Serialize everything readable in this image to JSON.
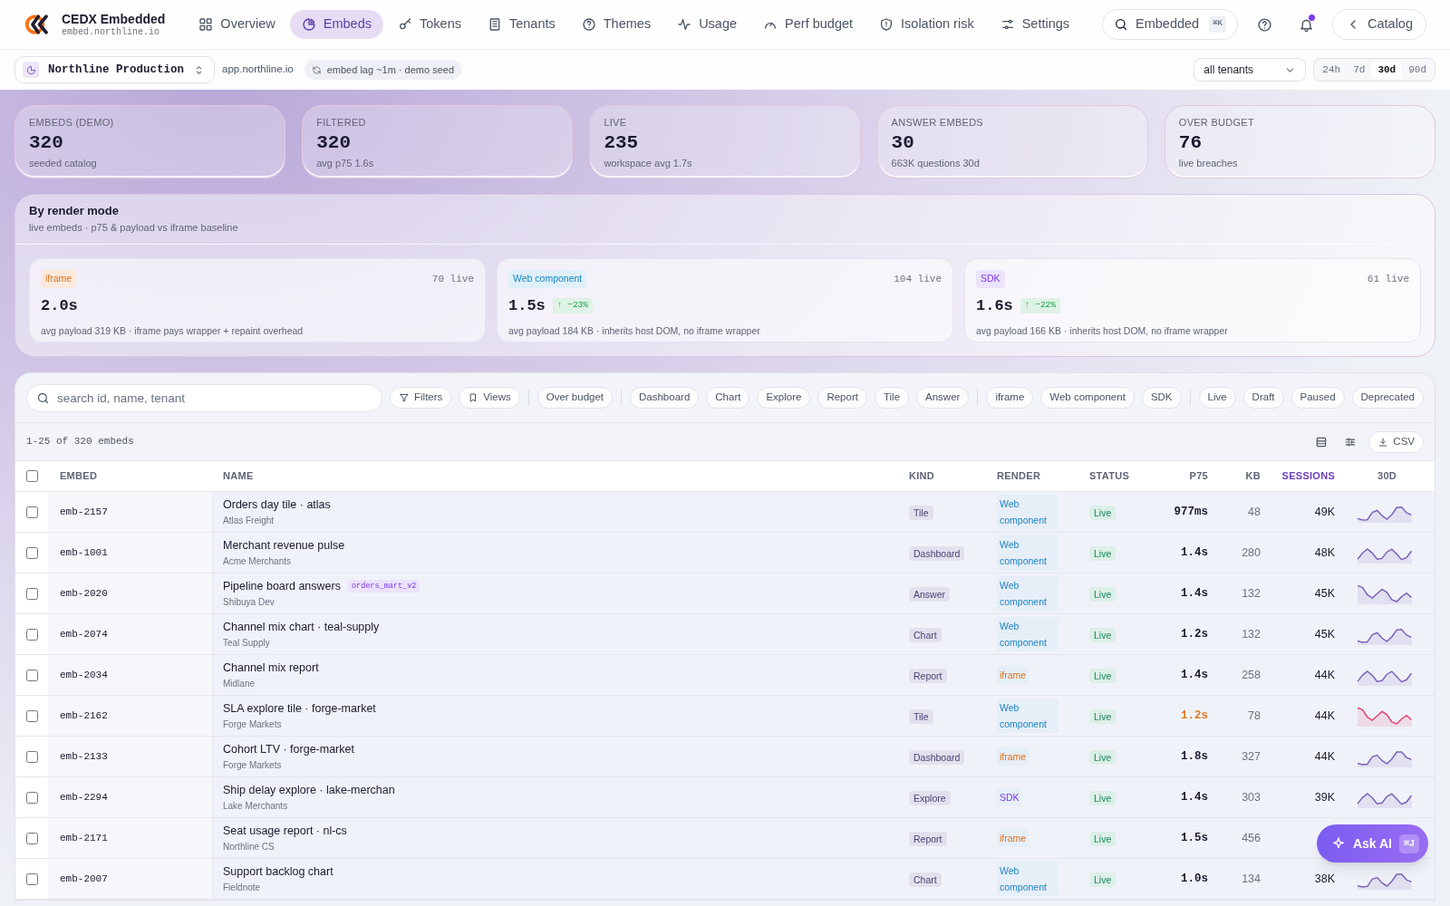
{
  "brand": {
    "name": "CEDX Embedded",
    "domain": "embed.northline.io"
  },
  "nav": [
    {
      "label": "Overview",
      "selected": false
    },
    {
      "label": "Embeds",
      "selected": true
    },
    {
      "label": "Tokens",
      "selected": false
    },
    {
      "label": "Tenants",
      "selected": false
    },
    {
      "label": "Themes",
      "selected": false
    },
    {
      "label": "Usage",
      "selected": false
    },
    {
      "label": "Perf budget",
      "selected": false
    },
    {
      "label": "Isolation risk",
      "selected": false
    },
    {
      "label": "Settings",
      "selected": false
    }
  ],
  "search": {
    "value": "Embedded",
    "shortcut": "⌘K"
  },
  "notifications": {
    "unread": true
  },
  "catalog_button": "Catalog",
  "workspace": {
    "name": "Northline Production",
    "host": "app.northline.io",
    "sync": "embed lag ~1m · demo seed"
  },
  "tenant_select": "all tenants",
  "ranges": [
    {
      "label": "24h",
      "selected": false
    },
    {
      "label": "7d",
      "selected": false
    },
    {
      "label": "30d",
      "selected": true
    },
    {
      "label": "90d",
      "selected": false
    }
  ],
  "stats": [
    {
      "label": "EMBEDS (DEMO)",
      "value": "320",
      "note": "seeded catalog"
    },
    {
      "label": "FILTERED",
      "value": "320",
      "note": "avg p75 1.6s"
    },
    {
      "label": "LIVE",
      "value": "235",
      "note": "workspace avg 1.7s"
    },
    {
      "label": "ANSWER EMBEDS",
      "value": "30",
      "note": "663K questions 30d"
    },
    {
      "label": "OVER BUDGET",
      "value": "76",
      "note": "live breaches"
    }
  ],
  "render_modes": {
    "title": "By render mode",
    "subtitle": "live embeds · p75 & payload vs iframe baseline",
    "modes": [
      {
        "tag": "iframe",
        "kind": "iframe",
        "count": "70 live",
        "p75": "2.0s",
        "note": "avg payload 319 KB · iframe pays wrapper + repaint overhead"
      },
      {
        "tag": "Web component",
        "kind": "web",
        "count": "104 live",
        "p75": "1.5s",
        "delta": "↑ −23%",
        "note": "avg payload 184 KB · inherits host DOM, no iframe wrapper"
      },
      {
        "tag": "SDK",
        "kind": "sdk",
        "count": "61 live",
        "p75": "1.6s",
        "delta": "↑ −22%",
        "note": "avg payload 166 KB · inherits host DOM, no iframe wrapper"
      }
    ]
  },
  "filter_bar": {
    "placeholder": "search id, name, tenant",
    "buttons": [
      "Filters",
      "Views"
    ],
    "chip_groups": [
      [
        "Over budget"
      ],
      [
        "Dashboard",
        "Chart",
        "Explore",
        "Report",
        "Tile",
        "Answer"
      ],
      [
        "iframe",
        "Web component",
        "SDK"
      ],
      [
        "Live",
        "Draft",
        "Paused",
        "Deprecated"
      ]
    ]
  },
  "range_text": "1-25 of 320 embeds",
  "export_button": "CSV",
  "table": {
    "columns": [
      {
        "label": "EMBED",
        "sorted": false
      },
      {
        "label": "NAME",
        "sorted": false
      },
      {
        "label": "KIND",
        "sorted": false
      },
      {
        "label": "RENDER",
        "sorted": false
      },
      {
        "label": "STATUS",
        "sorted": false
      },
      {
        "label": "P75",
        "sorted": false
      },
      {
        "label": "KB",
        "sorted": false
      },
      {
        "label": "SESSIONS",
        "sorted": true
      },
      {
        "label": "30D",
        "sorted": false
      }
    ],
    "all_checked": false,
    "rows": [
      {
        "checked": false,
        "id": "emb-2157",
        "name": "Orders day tile · atlas",
        "tenant": "Atlas Freight",
        "kind": "Tile",
        "render": {
          "label": "Web component",
          "color": "#1b84c4"
        },
        "status": "Live",
        "p75": "977ms",
        "over_budget": false,
        "kb": "48",
        "sessions": "49K"
      },
      {
        "checked": false,
        "id": "emb-1001",
        "name": "Merchant revenue pulse",
        "tenant": "Acme Merchants",
        "kind": "Dashboard",
        "render": {
          "label": "Web component",
          "color": "#1b84c4"
        },
        "status": "Live",
        "p75": "1.4s",
        "over_budget": false,
        "kb": "280",
        "sessions": "48K"
      },
      {
        "checked": false,
        "id": "emb-2020",
        "name": "Pipeline board answers",
        "tag": "orders_mart_v2",
        "tenant": "Shibuya Dev",
        "kind": "Answer",
        "render": {
          "label": "Web component",
          "color": "#1b84c4"
        },
        "status": "Live",
        "p75": "1.4s",
        "over_budget": false,
        "kb": "132",
        "sessions": "45K"
      },
      {
        "checked": false,
        "id": "emb-2074",
        "name": "Channel mix chart · teal-supply",
        "tenant": "Teal Supply",
        "kind": "Chart",
        "render": {
          "label": "Web component",
          "color": "#1b84c4"
        },
        "status": "Live",
        "p75": "1.2s",
        "over_budget": false,
        "kb": "132",
        "sessions": "45K"
      },
      {
        "checked": false,
        "id": "emb-2034",
        "name": "Channel mix report",
        "tenant": "Midlane",
        "kind": "Report",
        "render": {
          "label": "iframe",
          "color": "#d9731a"
        },
        "status": "Live",
        "p75": "1.4s",
        "over_budget": false,
        "kb": "258",
        "sessions": "44K"
      },
      {
        "checked": false,
        "id": "emb-2162",
        "name": "SLA explore tile · forge-market",
        "tenant": "Forge Markets",
        "kind": "Tile",
        "render": {
          "label": "Web component",
          "color": "#1b84c4"
        },
        "status": "Live",
        "p75": "1.2s",
        "over_budget": true,
        "kb": "78",
        "sessions": "44K"
      },
      {
        "checked": false,
        "id": "emb-2133",
        "name": "Cohort LTV · forge-market",
        "tenant": "Forge Markets",
        "kind": "Dashboard",
        "render": {
          "label": "iframe",
          "color": "#d9731a"
        },
        "status": "Live",
        "p75": "1.8s",
        "over_budget": false,
        "kb": "327",
        "sessions": "44K"
      },
      {
        "checked": false,
        "id": "emb-2294",
        "name": "Ship delay explore · lake-merchan",
        "tenant": "Lake Merchants",
        "kind": "Explore",
        "render": {
          "label": "SDK",
          "color": "#7c3aed"
        },
        "status": "Live",
        "p75": "1.4s",
        "over_budget": false,
        "kb": "303",
        "sessions": "39K"
      },
      {
        "checked": false,
        "id": "emb-2171",
        "name": "Seat usage report · nl-cs",
        "tenant": "Northline CS",
        "kind": "Report",
        "render": {
          "label": "iframe",
          "color": "#d9731a"
        },
        "status": "Live",
        "p75": "1.5s",
        "over_budget": false,
        "kb": "456"
      },
      {
        "checked": false,
        "id": "emb-2007",
        "name": "Support backlog chart",
        "tenant": "Fieldnote",
        "kind": "Chart",
        "render": {
          "label": "Web component",
          "color": "#1b84c4"
        },
        "status": "Live",
        "p75": "1.0s",
        "over_budget": false,
        "kb": "134",
        "sessions": "38K"
      }
    ]
  },
  "ask_ai": {
    "label": "Ask AI",
    "shortcut": "⌘J"
  }
}
